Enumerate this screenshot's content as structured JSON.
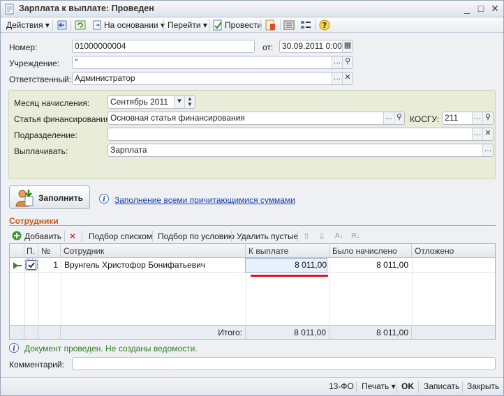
{
  "window": {
    "title": "Зарплата к выплате: Проведен",
    "minimize": "_",
    "maximize": "□",
    "close": "✕"
  },
  "toolbar": {
    "actions": "Действия",
    "based_on": "На основании",
    "go_to": "Перейти",
    "post": "Провести",
    "help": "?"
  },
  "header": {
    "number_label": "Номер:",
    "number_value": "01000000004",
    "date_label": "от:",
    "date_value": "30.09.2011 0:00:",
    "institution_label": "Учреждение:",
    "institution_value": "\"",
    "responsible_label": "Ответственный:",
    "responsible_value": "Администратор"
  },
  "panel": {
    "month_label": "Месяц начисления:",
    "month_value": "Сентябрь 2011",
    "finance_label": "Статья финансирования:",
    "finance_value": "Основная статья финансирования",
    "kosgu_label": "КОСГУ:",
    "kosgu_value": "211",
    "division_label": "Подразделение:",
    "division_value": "",
    "pay_label": "Выплачивать:",
    "pay_value": "Зарплата"
  },
  "fill": {
    "button_label": "Заполнить",
    "info_link": "Заполнение всеми причитающимися суммами",
    "info_icon": "i"
  },
  "employees": {
    "section_title": "Сотрудники",
    "toolbar": {
      "add": "Добавить",
      "pick_list": "Подбор списком",
      "pick_condition": "Подбор по условию",
      "delete_empty": "Удалить пустые"
    },
    "columns": {
      "flag": "П.",
      "num": "№",
      "employee": "Сотрудник",
      "to_pay": "К выплате",
      "accrued": "Было начислено",
      "deferred": "Отложено"
    },
    "rows": [
      {
        "num": "1",
        "employee": "Врунгель Христофор Бонифатьевич",
        "to_pay": "8 011,00",
        "accrued": "8 011,00",
        "deferred": ""
      }
    ],
    "totals": {
      "label": "Итого:",
      "to_pay": "8 011,00",
      "accrued": "8 011,00"
    }
  },
  "status": {
    "message": "Документ проведен. Не созданы ведомости."
  },
  "comment": {
    "label": "Комментарий:",
    "value": ""
  },
  "bottom": {
    "form": "13-ФО",
    "print": "Печать",
    "ok": "OK",
    "save": "Записать",
    "close": "Закрыть"
  },
  "colors": {
    "highlight_underline": "#e0161b",
    "panel_bg": "#e9ecd9",
    "section_title": "#c5591a",
    "link": "#1a3fa6",
    "status": "#2e7d20"
  }
}
